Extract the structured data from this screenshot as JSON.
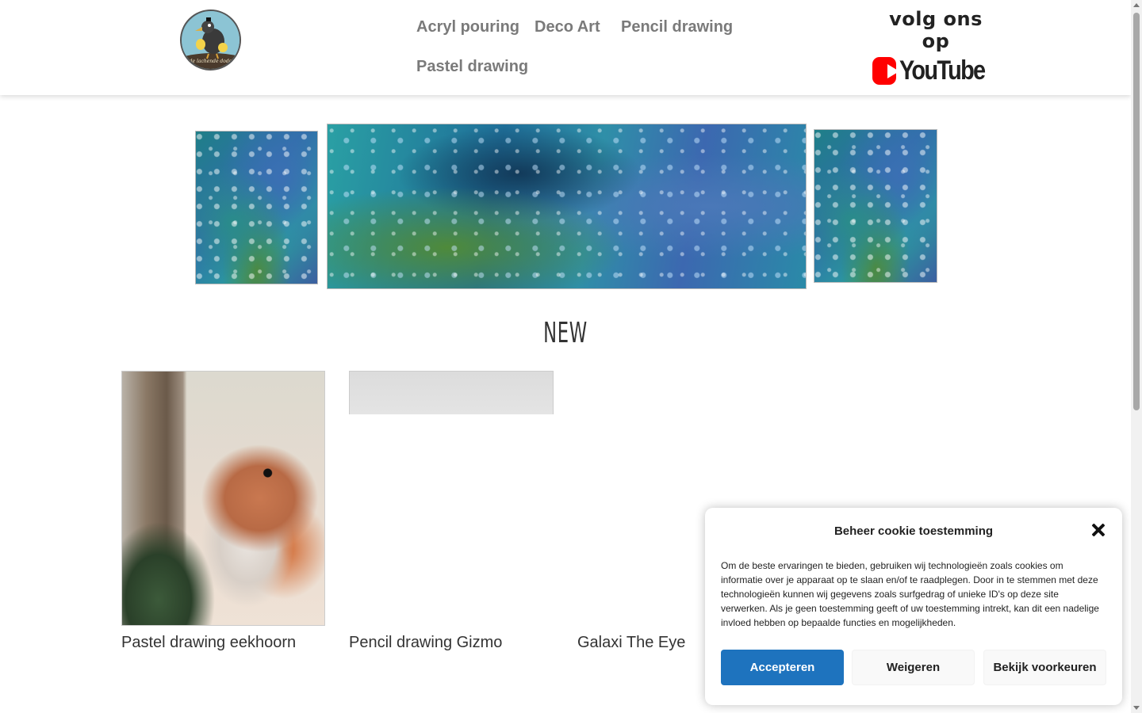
{
  "header": {
    "logo_text": "de lachende dodo",
    "nav": [
      {
        "label": "Acryl pouring"
      },
      {
        "label": "Deco Art"
      },
      {
        "label": "Pencil drawing"
      },
      {
        "label": "Pastel drawing"
      }
    ],
    "follow_text": "volg ons op",
    "youtube_label": "YouTube",
    "youtube_color": "#ff0000"
  },
  "banner": {
    "images": [
      "acryl-pouring-left",
      "acryl-pouring-center",
      "acryl-pouring-right"
    ]
  },
  "section_title": "NEW",
  "products": [
    {
      "title": "Pastel drawing eekhoorn"
    },
    {
      "title": "Pencil drawing Gizmo"
    },
    {
      "title": "Galaxi The Eye"
    }
  ],
  "cookie": {
    "title": "Beheer cookie toestemming",
    "body": "Om de beste ervaringen te bieden, gebruiken wij technologieën zoals cookies om informatie over je apparaat op te slaan en/of te raadplegen. Door in te stemmen met deze technologieën kunnen wij gegevens zoals surfgedrag of unieke ID's op deze site verwerken. Als je geen toestemming geeft of uw toestemming intrekt, kan dit een nadelige invloed hebben op bepaalde functies en mogelijkheden.",
    "accept_label": "Accepteren",
    "deny_label": "Weigeren",
    "prefs_label": "Bekijk voorkeuren",
    "accent_color": "#1e73be"
  }
}
